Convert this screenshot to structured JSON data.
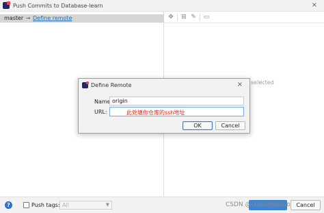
{
  "window": {
    "title": "Push Commits to Database-learn",
    "close_glyph": "×",
    "icon": "intellij-icon"
  },
  "commits": {
    "local_branch": "master",
    "arrow": "→",
    "define_remote_link": "Define remote"
  },
  "details": {
    "toolbar_icons": [
      "expand-icon",
      "group-by-icon",
      "edit-icon",
      "preview-icon"
    ],
    "empty_text": "selected"
  },
  "dialog": {
    "title": "Define Remote",
    "close_glyph": "×",
    "name_label": "Name:",
    "name_value": "origin",
    "url_label": "URL:",
    "url_value": "",
    "annotation": "此处填你仓库的ssh地址",
    "ok_label": "OK",
    "cancel_label": "Cancel"
  },
  "bottom": {
    "help_glyph": "?",
    "push_tags_label": "Push tags:",
    "push_tags_checked": false,
    "tags_select_value": "All",
    "watermark": "CSDN @Luoluoluoluo",
    "push_label": "",
    "cancel_label": "Cancel"
  },
  "colors": {
    "link": "#2470b3",
    "annotation": "#e0251b",
    "primary_button": "#3d86d6"
  }
}
